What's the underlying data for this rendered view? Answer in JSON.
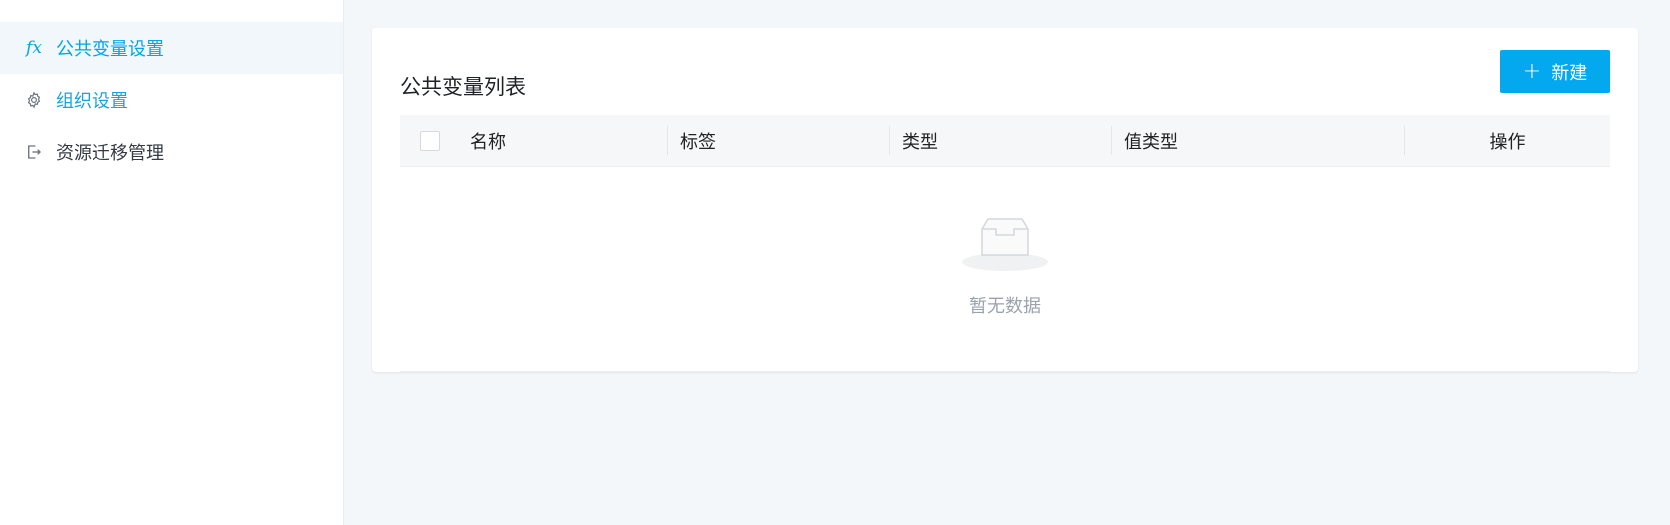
{
  "sidebar": {
    "items": [
      {
        "label": "公共变量设置",
        "icon": "fx-icon",
        "active": true
      },
      {
        "label": "组织设置",
        "icon": "gear-icon",
        "active": false
      },
      {
        "label": "资源迁移管理",
        "icon": "export-icon",
        "active": false
      }
    ]
  },
  "main": {
    "title": "公共变量列表",
    "new_button_label": "新建",
    "table": {
      "columns": [
        "名称",
        "标签",
        "类型",
        "值类型",
        "操作"
      ],
      "rows": []
    },
    "empty_text": "暂无数据"
  },
  "colors": {
    "accent": "#00a6e6",
    "primary_button": "#04a8ef",
    "active_menu_bg": "#f1f7fb"
  }
}
